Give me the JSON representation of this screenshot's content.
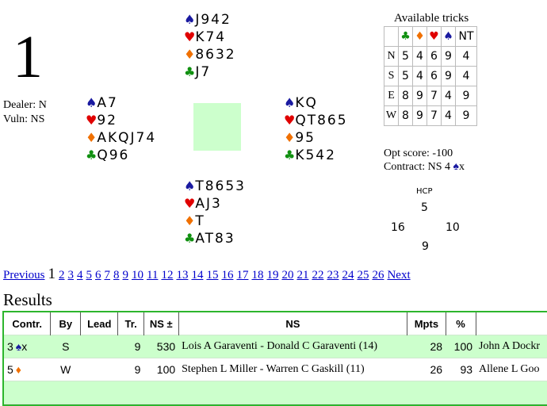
{
  "board": {
    "number": "1",
    "dealer": "Dealer: N",
    "vuln": "Vuln: NS"
  },
  "hands": {
    "north": {
      "spades": "J942",
      "hearts": "K74",
      "diamonds": "8632",
      "clubs": "J7"
    },
    "west": {
      "spades": "A7",
      "hearts": "92",
      "diamonds": "AKQJ74",
      "clubs": "Q96"
    },
    "east": {
      "spades": "KQ",
      "hearts": "QT865",
      "diamonds": "95",
      "clubs": "K542"
    },
    "south": {
      "spades": "T8653",
      "hearts": "AJ3",
      "diamonds": "T",
      "clubs": "AT83"
    }
  },
  "suit_symbols": {
    "spades": "♠",
    "hearts": "♥",
    "diamonds": "♦",
    "clubs": "♣"
  },
  "tricks": {
    "title": "Available tricks",
    "header_nt": "NT",
    "rows": [
      {
        "seat": "N",
        "c": "5",
        "d": "4",
        "h": "6",
        "s": "9",
        "nt": "4"
      },
      {
        "seat": "S",
        "c": "5",
        "d": "4",
        "h": "6",
        "s": "9",
        "nt": "4"
      },
      {
        "seat": "E",
        "c": "8",
        "d": "9",
        "h": "7",
        "s": "4",
        "nt": "9"
      },
      {
        "seat": "W",
        "c": "8",
        "d": "9",
        "h": "7",
        "s": "4",
        "nt": "9"
      }
    ]
  },
  "opt": {
    "score": "Opt score: -100",
    "contract_prefix": "Contract: NS 4 ",
    "contract_suffix": "x"
  },
  "hcp": {
    "label": "HCP",
    "north": "5",
    "west": "16",
    "east": "10",
    "south": "9"
  },
  "pager": {
    "previous": "Previous",
    "current": "1",
    "pages": [
      "2",
      "3",
      "4",
      "5",
      "6",
      "7",
      "8",
      "9",
      "10",
      "11",
      "12",
      "13",
      "14",
      "15",
      "16",
      "17",
      "18",
      "19",
      "20",
      "21",
      "22",
      "23",
      "24",
      "25",
      "26"
    ],
    "next": "Next"
  },
  "results": {
    "heading": "Results",
    "columns": [
      "Contr.",
      "By",
      "Lead",
      "Tr.",
      "NS ±",
      "NS",
      "Mpts",
      "%",
      ""
    ],
    "rows": [
      {
        "contract_level": "3",
        "contract_suit": "♠",
        "contract_suit_key": "sp",
        "contract_dbl": "x",
        "by": "S",
        "lead": "",
        "tricks": "9",
        "ns_score": "530",
        "ns": "Lois A Garaventi - Donald C Garaventi (14)",
        "mpts": "28",
        "pct": "100",
        "ew": "John A Dockr",
        "green": true
      },
      {
        "contract_level": "5",
        "contract_suit": "♦",
        "contract_suit_key": "di",
        "contract_dbl": "",
        "by": "W",
        "lead": "",
        "tricks": "9",
        "ns_score": "100",
        "ns": "Stephen L Miller - Warren C Gaskill (11)",
        "mpts": "26",
        "pct": "93",
        "ew": "Allene L Goo",
        "green": false
      },
      {
        "contract_level": "",
        "contract_suit": "",
        "contract_suit_key": "",
        "contract_dbl": "",
        "by": "",
        "lead": "",
        "tricks": "",
        "ns_score": "",
        "ns": "",
        "mpts": "",
        "pct": "",
        "ew": "",
        "green": true
      }
    ]
  }
}
